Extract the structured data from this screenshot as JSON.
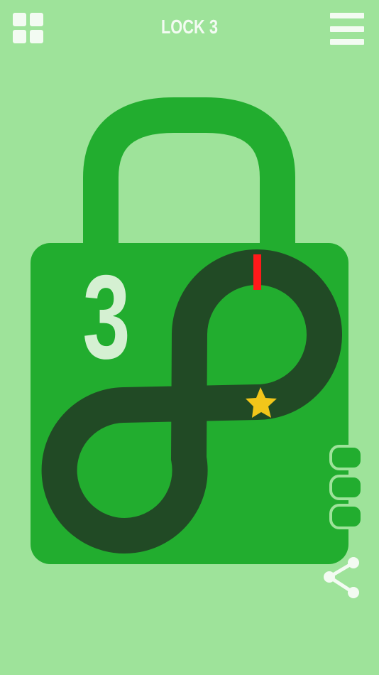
{
  "header": {
    "title": "LOCK 3",
    "levels_button_icon": "grid-icon",
    "menu_button_icon": "hamburger-menu-icon"
  },
  "lock": {
    "number": "3",
    "shackle_color": "#22ad2f",
    "body_color": "#22ad2f",
    "track_color": "#214a25",
    "pin_color": "#ff1a1a",
    "star_color": "#f2c61a",
    "attempts_indicator_count": 3
  },
  "share": {
    "icon": "share-icon"
  },
  "colors": {
    "background": "#9ee39a",
    "foreground_light": "#f3fbf2"
  }
}
